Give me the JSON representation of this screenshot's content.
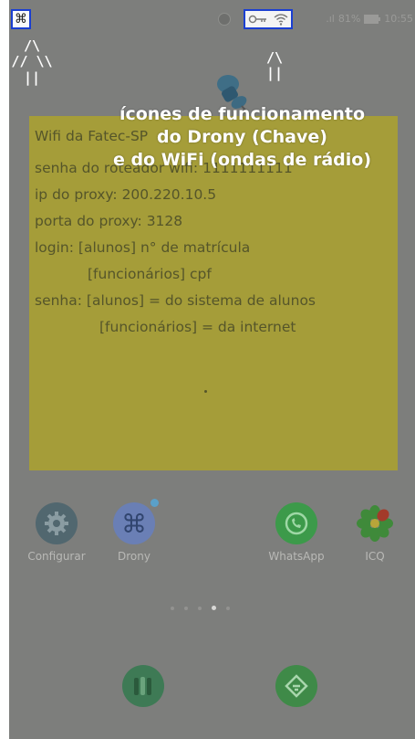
{
  "status_bar": {
    "signal": ".ıl",
    "battery": "81%",
    "time": "10:55"
  },
  "annotations": {
    "left_arrow": "/\\\n// \\\\\n||",
    "right_arrow": "/\\\n||",
    "caption": "ícones de funcionamento\ndo Drony (Chave)\ne do WiFi (ondas de rádio)"
  },
  "note": {
    "lines": [
      "Wifi da Fatec-SP",
      "senha do roteador wifi: 1111111111",
      "ip do proxy: 200.220.10.5",
      "porta do proxy: 3128",
      "login: [alunos] n° de matrícula",
      "[funcionários] cpf",
      "senha: [alunos] = do sistema de alunos",
      "[funcionários] = da internet"
    ]
  },
  "apps": [
    {
      "label": "Configurar",
      "icon": "gear-icon"
    },
    {
      "label": "Drony",
      "icon": "drony-icon"
    },
    {
      "label": "WhatsApp",
      "icon": "whatsapp-icon"
    },
    {
      "label": "ICQ",
      "icon": "icq-icon"
    }
  ],
  "dock": [
    {
      "icon": "books-icon"
    },
    {
      "icon": "feedly-icon"
    }
  ],
  "colors": {
    "highlight_border": "#1b3fd1",
    "note_bg": "#a59d39",
    "wallpaper": "#7d7e7c"
  }
}
